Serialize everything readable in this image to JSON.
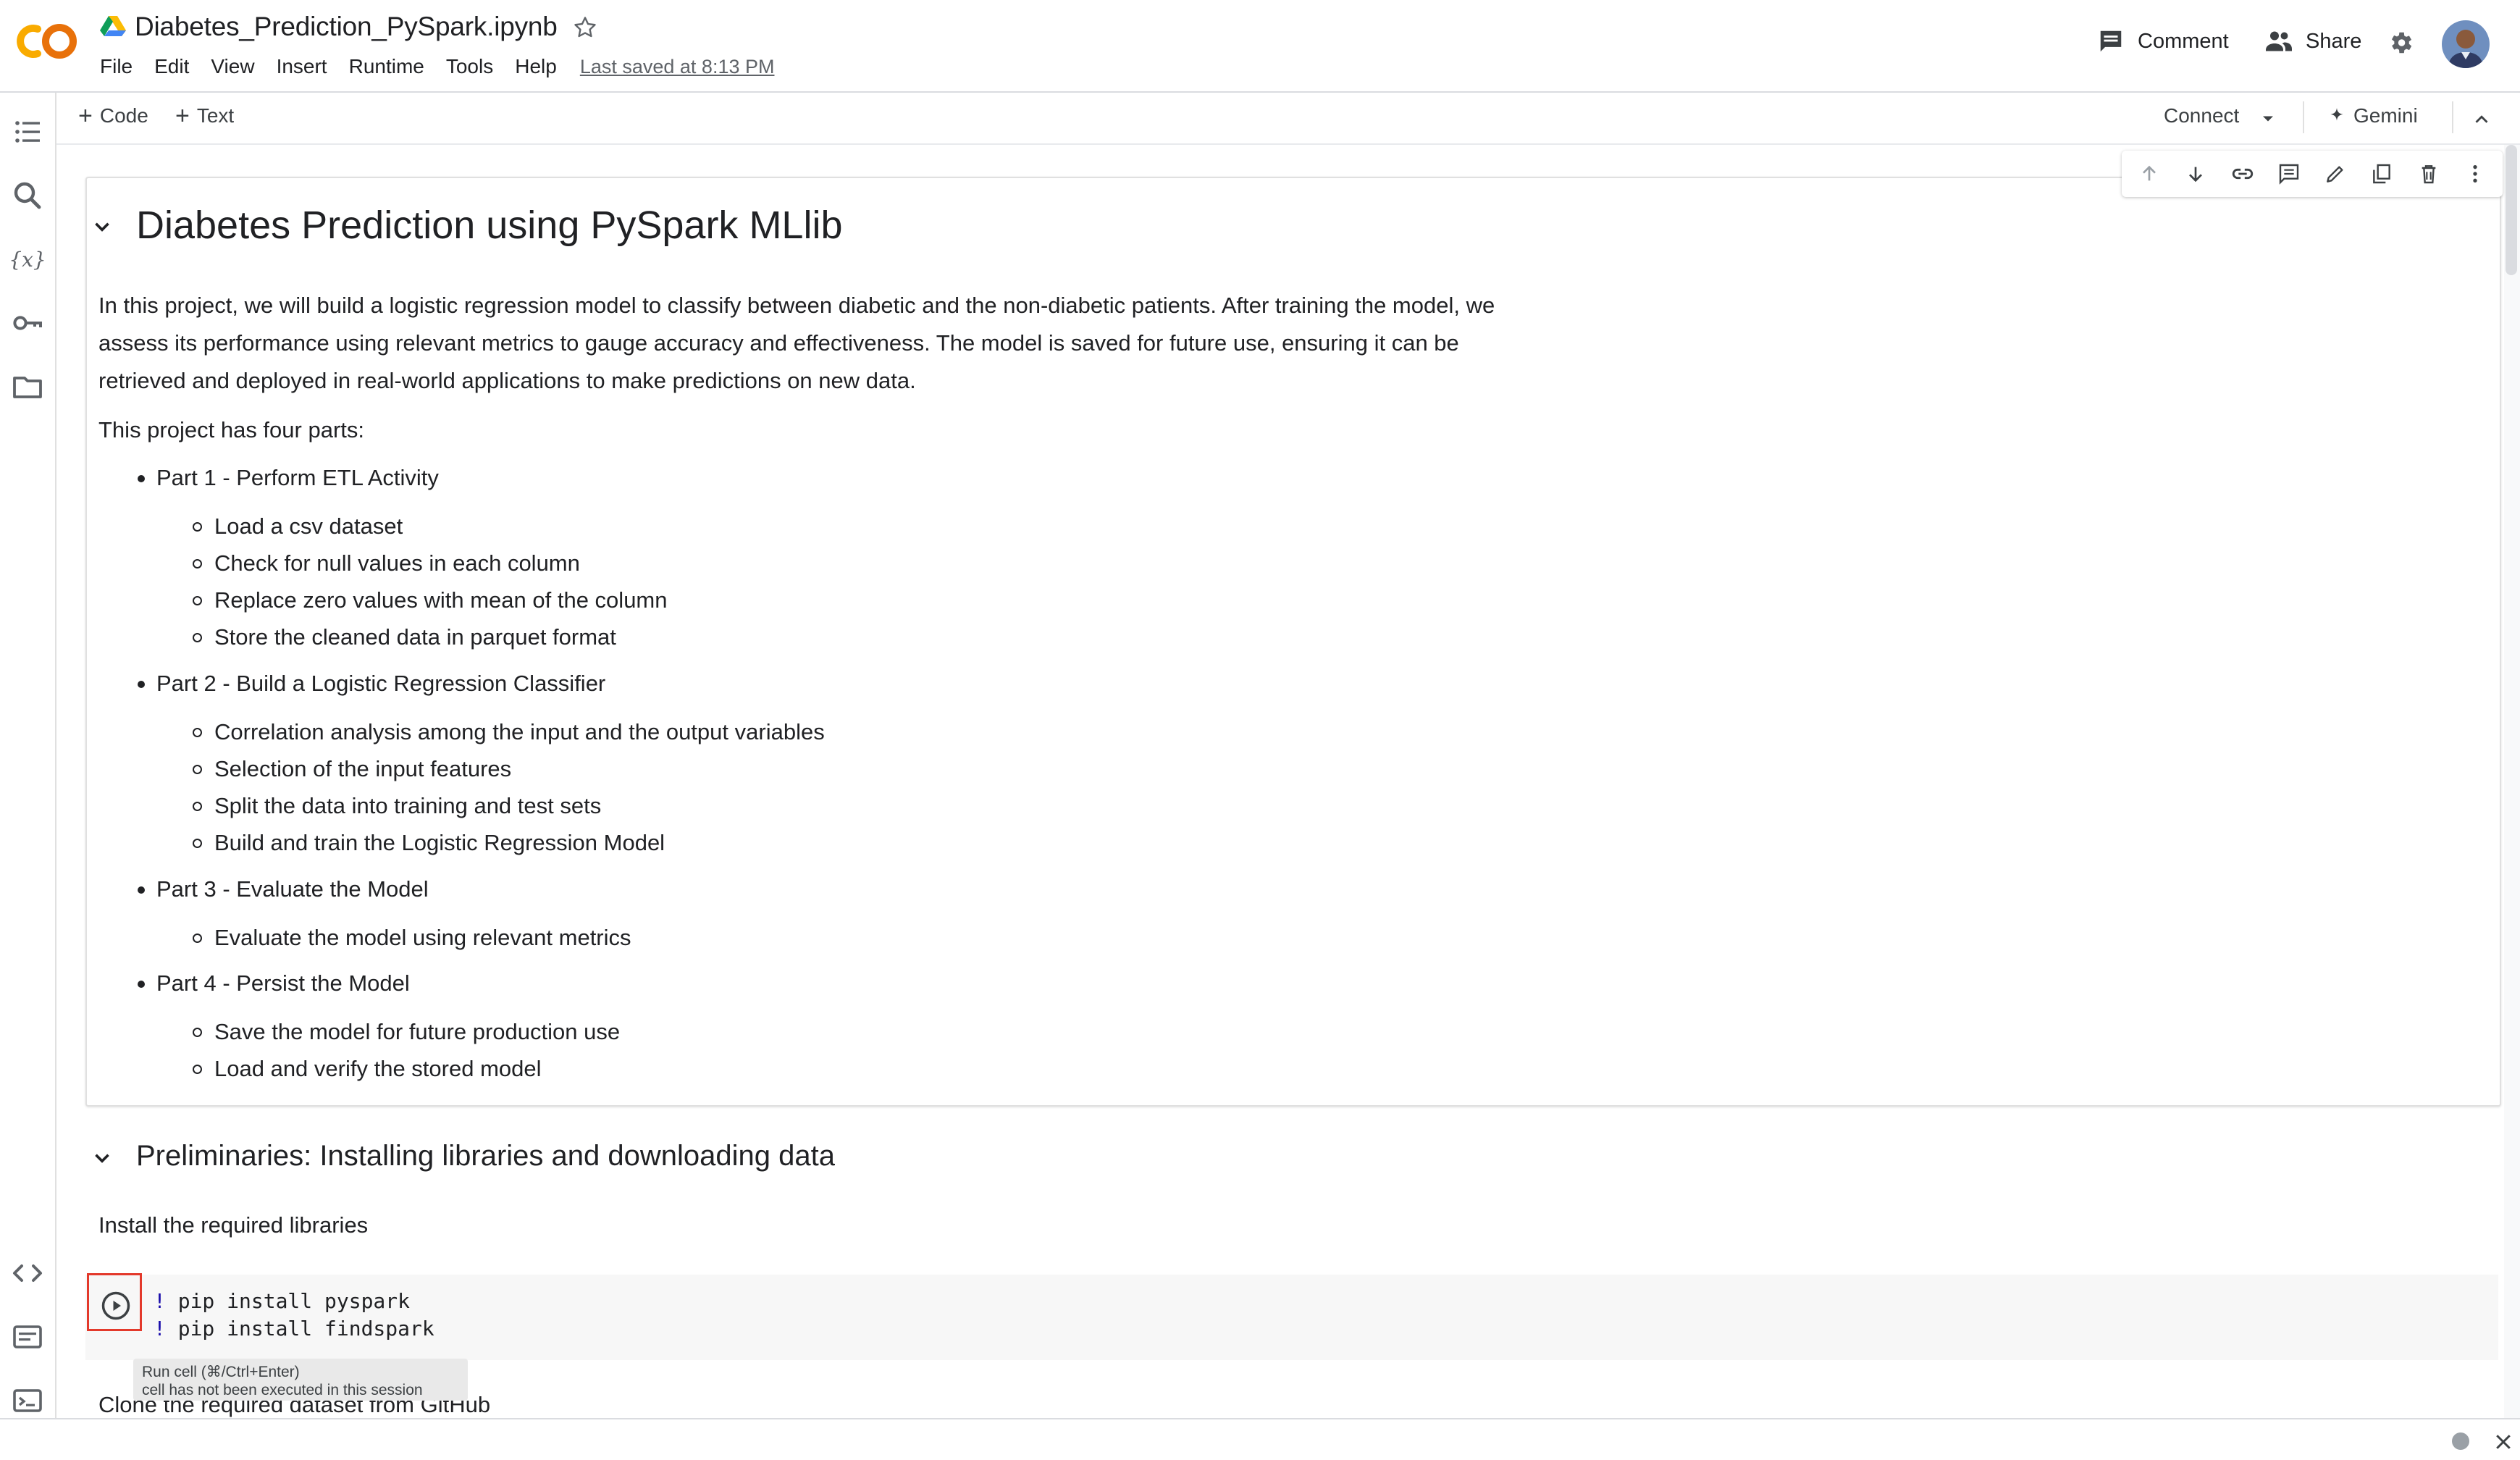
{
  "colors": {
    "accent_orange": "#f9ab00",
    "highlight_red": "#e3392b",
    "text": "#202124",
    "muted": "#5f6368",
    "code_bg": "#f7f7f7",
    "keyword_blue": "#1a0dab"
  },
  "header": {
    "logo": "colab-logo",
    "notebook_title": "Diabetes_Prediction_PySpark.ipynb",
    "menu": [
      "File",
      "Edit",
      "View",
      "Insert",
      "Runtime",
      "Tools",
      "Help"
    ],
    "last_saved": "Last saved at 8:13 PM",
    "comment_label": "Comment",
    "share_label": "Share"
  },
  "rail": {
    "icons": [
      "table-of-contents-icon",
      "search-icon",
      "variables-icon",
      "secrets-key-icon",
      "files-folder-icon",
      "code-snippets-icon",
      "command-palette-icon",
      "terminal-icon"
    ]
  },
  "toolbar": {
    "add_code": "Code",
    "add_text": "Text",
    "connect": "Connect",
    "gemini": "Gemini"
  },
  "cell_toolbar": {
    "icons": [
      "move-up-icon",
      "move-down-icon",
      "link-icon",
      "comment-icon",
      "edit-icon",
      "mirror-cell-icon",
      "delete-icon",
      "more-options-icon"
    ]
  },
  "markdown": {
    "title": "Diabetes Prediction using PySpark MLlib",
    "intro_lines": [
      "In this project, we will build a logistic regression model to classify between diabetic and the non-diabetic patients. After training the model, we",
      "assess its performance using relevant metrics to gauge accuracy and effectiveness. The model is saved for future use, ensuring it can be",
      "retrieved and deployed in real-world applications to make predictions on new data."
    ],
    "parts_intro": "This project has four parts:",
    "parts": [
      {
        "title": "Part 1 - Perform ETL Activity",
        "items": [
          "Load a csv dataset",
          "Check for null values in each column",
          "Replace zero values with mean of the column",
          "Store the cleaned data in parquet format"
        ]
      },
      {
        "title": "Part 2 - Build a Logistic Regression Classifier",
        "items": [
          "Correlation analysis among the input and the output variables",
          "Selection of the input features",
          "Split the data into training and test sets",
          "Build and train the Logistic Regression Model"
        ]
      },
      {
        "title": "Part 3 - Evaluate the Model",
        "items": [
          "Evaluate the model using relevant metrics"
        ]
      },
      {
        "title": "Part 4 - Persist the Model",
        "items": [
          "Save the model for future production use",
          "Load and verify the stored model"
        ]
      }
    ]
  },
  "section2": {
    "title": "Preliminaries: Installing libraries and downloading data",
    "install_text": "Install the required libraries",
    "clone_text": "Clone the required dataset from GitHub"
  },
  "code_cell": {
    "lines": [
      {
        "bang": "!",
        "code": " pip install pyspark"
      },
      {
        "bang": "!",
        "code": " pip install findspark"
      }
    ]
  },
  "tooltip": {
    "line1": "Run cell (⌘/Ctrl+Enter)",
    "line2": "cell has not been executed in this session"
  }
}
